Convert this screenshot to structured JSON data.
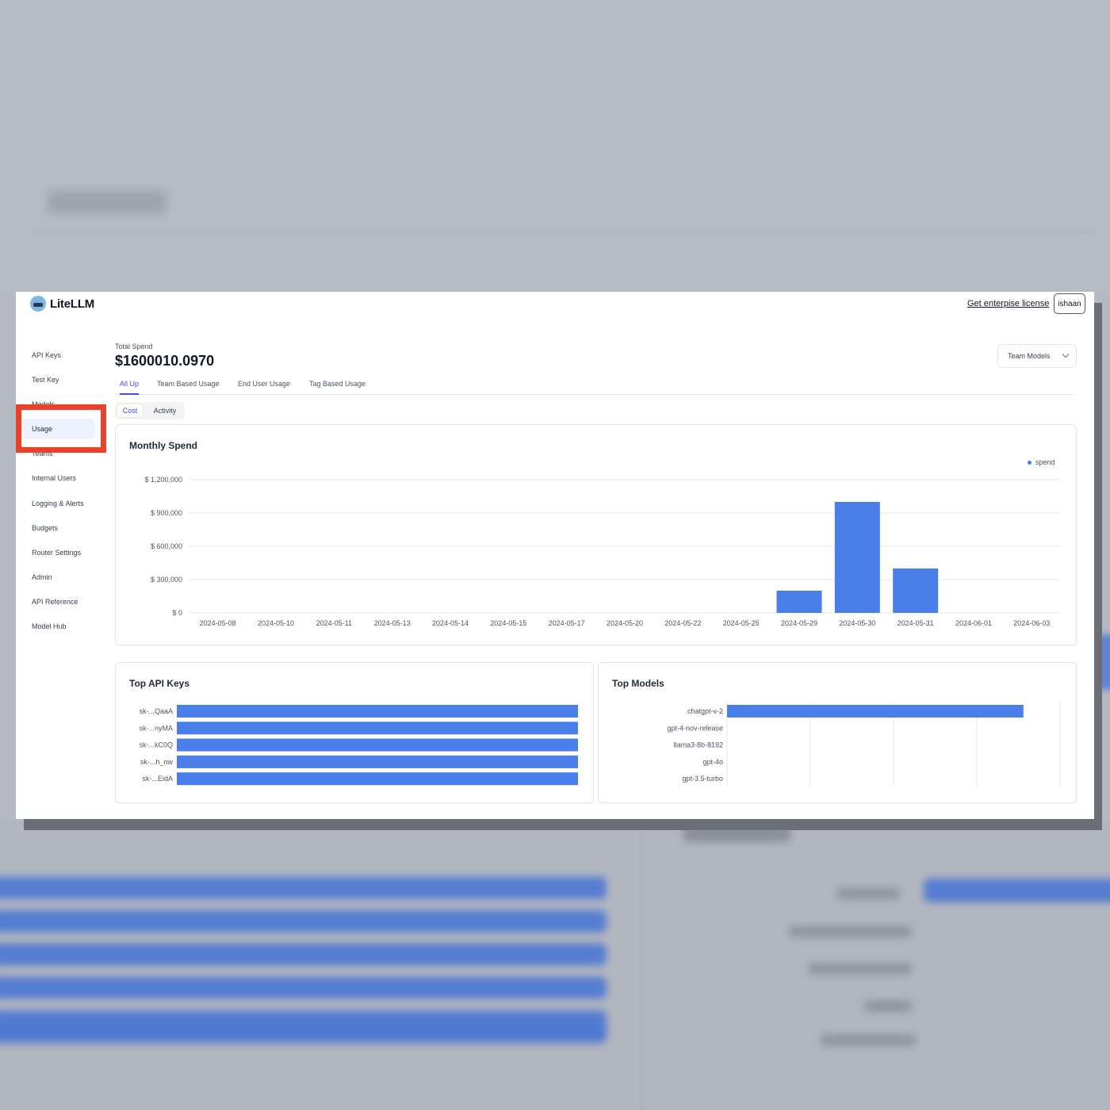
{
  "header": {
    "app_name": "LiteLLM",
    "enterprise_link": "Get enterpise license",
    "user": "ishaan"
  },
  "sidebar": {
    "items": [
      {
        "label": "API Keys"
      },
      {
        "label": "Test Key"
      },
      {
        "label": "Models"
      },
      {
        "label": "Usage",
        "active": true
      },
      {
        "label": "Teams"
      },
      {
        "label": "Internal Users"
      },
      {
        "label": "Logging & Alerts"
      },
      {
        "label": "Budgets"
      },
      {
        "label": "Router Settings"
      },
      {
        "label": "Admin"
      },
      {
        "label": "API Reference"
      },
      {
        "label": "Model Hub"
      }
    ]
  },
  "summary": {
    "total_label": "Total Spend",
    "total_value": "$1600010.0970"
  },
  "filter": {
    "selected": "Team Models"
  },
  "tabs": [
    {
      "label": "All Up",
      "active": true
    },
    {
      "label": "Team Based Usage"
    },
    {
      "label": "End User Usage"
    },
    {
      "label": "Tag Based Usage"
    }
  ],
  "toggle": {
    "cost": "Cost",
    "activity": "Activity",
    "selected": "Cost"
  },
  "monthly_spend": {
    "title": "Monthly Spend"
  },
  "top_api_keys": {
    "title": "Top API Keys"
  },
  "top_models": {
    "title": "Top Models"
  },
  "colors": {
    "bar": "#4a7fea",
    "accent": "#4f46e5",
    "highlight": "#e8432a"
  },
  "chart_data": [
    {
      "type": "bar",
      "title": "Monthly Spend",
      "categories": [
        "2024-05-08",
        "2024-05-10",
        "2024-05-11",
        "2024-05-13",
        "2024-05-14",
        "2024-05-15",
        "2024-05-17",
        "2024-05-20",
        "2024-05-22",
        "2024-05-25",
        "2024-05-29",
        "2024-05-30",
        "2024-05-31",
        "2024-06-01",
        "2024-06-03"
      ],
      "series": [
        {
          "name": "spend",
          "values": [
            0,
            0,
            0,
            0,
            0,
            0,
            0,
            0,
            0,
            0,
            200000,
            1000000,
            400000,
            0,
            0
          ]
        }
      ],
      "ylim": [
        0,
        1200000
      ],
      "yticks": [
        0,
        300000,
        600000,
        900000,
        1200000
      ],
      "ytick_labels": [
        "$ 0",
        "$ 300,000",
        "$ 600,000",
        "$ 900,000",
        "$ 1,200,000"
      ],
      "legend": "top-right",
      "grid": true
    },
    {
      "type": "bar",
      "orientation": "horizontal",
      "title": "Top API Keys",
      "categories": [
        "sk-...QaaA",
        "sk-...nyMA",
        "sk-...kC0Q",
        "sk-...h_nw",
        "sk-...EidA"
      ],
      "values": [
        1,
        1,
        1,
        1,
        1
      ]
    },
    {
      "type": "bar",
      "orientation": "horizontal",
      "title": "Top Models",
      "categories": [
        "chatgpt-v-2",
        "gpt-4-nov-release",
        "llama3-8b-8192",
        "gpt-4o",
        "gpt-3.5-turbo"
      ],
      "values": [
        0.89,
        0,
        0,
        0,
        0
      ],
      "grid": true
    }
  ]
}
